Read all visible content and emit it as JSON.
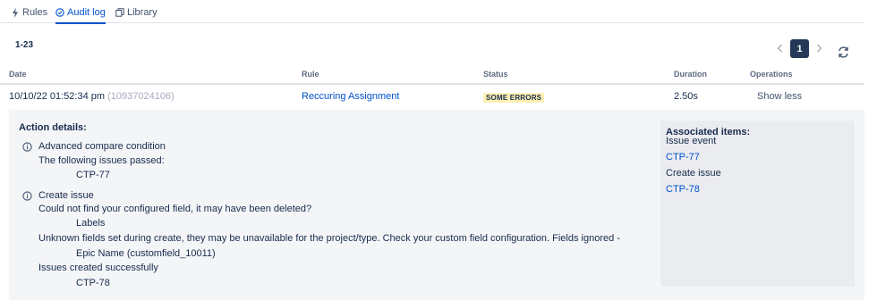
{
  "tabs": [
    {
      "label": "Rules",
      "icon": "lightning-icon"
    },
    {
      "label": "Audit log",
      "icon": "check-circle-icon",
      "active": true
    },
    {
      "label": "Library",
      "icon": "copy-icon"
    }
  ],
  "results_count": "1-23",
  "pagination": {
    "current_page": "1"
  },
  "table": {
    "headers": [
      "Date",
      "Rule",
      "Status",
      "Duration",
      "Operations"
    ],
    "row": {
      "date": "10/10/22 01:52:34 pm",
      "id": "(10937024106)",
      "rule": "Reccuring Assignment",
      "status": "SOME ERRORS",
      "duration": "2.50s",
      "operation": "Show less"
    }
  },
  "details": {
    "title": "Action details:",
    "actions": [
      {
        "name": "Advanced compare condition",
        "lines": [
          {
            "text": "The following issues passed:",
            "indent": false
          },
          {
            "text": "CTP-77",
            "indent": true
          }
        ]
      },
      {
        "name": "Create issue",
        "lines": [
          {
            "text": "Could not find your configured field, it may have been deleted?",
            "indent": false
          },
          {
            "text": "Labels",
            "indent": true
          },
          {
            "text": "Unknown fields set during create, they may be unavailable for the project/type. Check your custom field configuration. Fields ignored -",
            "indent": false
          },
          {
            "text": "Epic Name (customfield_10011)",
            "indent": true
          },
          {
            "text": "Issues created successfully",
            "indent": false
          },
          {
            "text": "CTP-78",
            "indent": true
          }
        ]
      }
    ],
    "associated": {
      "title": "Associated items:",
      "items": [
        {
          "text": "Issue event",
          "link": false
        },
        {
          "text": "CTP-77",
          "link": true
        },
        {
          "text": "Create issue",
          "link": false
        },
        {
          "text": "CTP-78",
          "link": true
        }
      ]
    }
  },
  "colors": {
    "link": "#0052cc",
    "badge_bg": "#fff0b3",
    "page_active_bg": "#253858",
    "panel_bg": "#f4f5f7"
  }
}
